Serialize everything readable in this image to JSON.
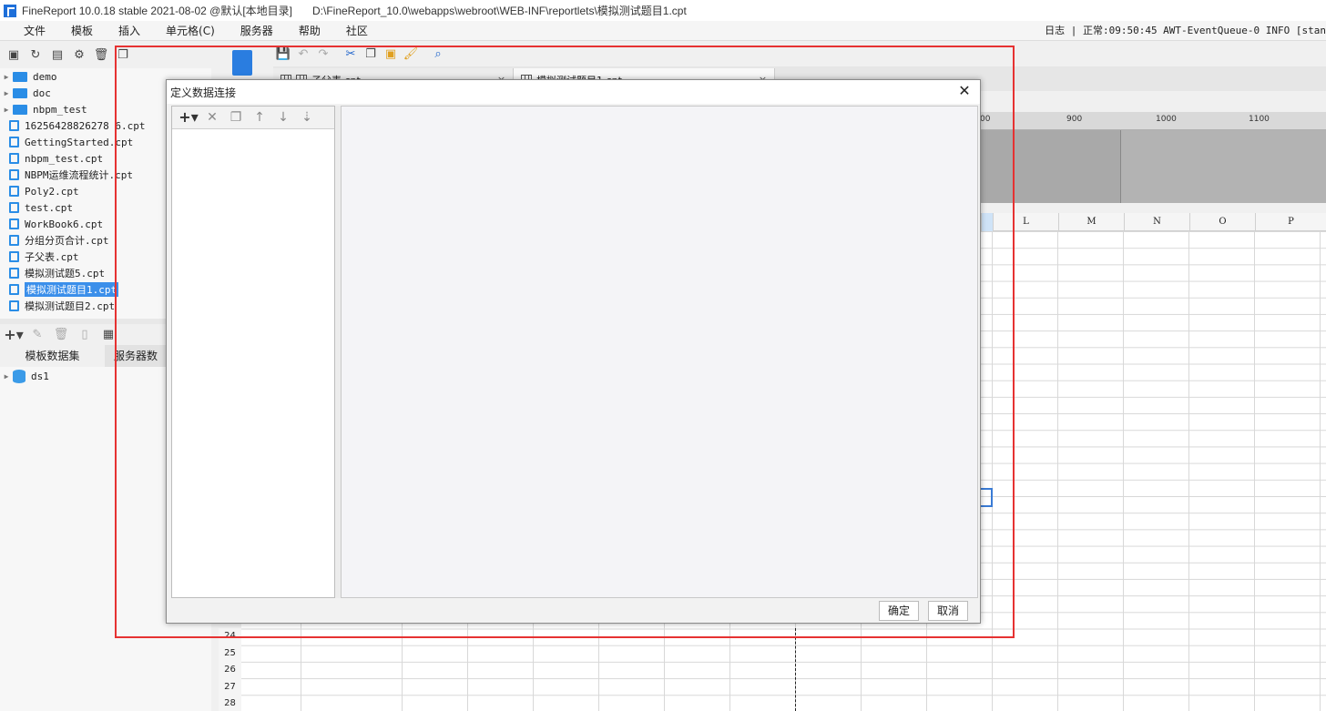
{
  "window": {
    "title": "FineReport 10.0.18 stable 2021-08-02 @默认[本地目录]",
    "path": "D:\\FineReport_10.0\\webapps\\webroot\\WEB-INF\\reportlets\\模拟测试题目1.cpt"
  },
  "menu": [
    "文件",
    "模板",
    "插入",
    "单元格(C)",
    "服务器",
    "帮助",
    "社区"
  ],
  "status": "日志 | 正常:09:50:45 AWT-EventQueue-0 INFO [stan",
  "tree": {
    "items": [
      {
        "label": "demo",
        "type": "folder"
      },
      {
        "label": "doc",
        "type": "folder"
      },
      {
        "label": "nbpm_test",
        "type": "folder"
      },
      {
        "label": "16256428826278 6.cpt",
        "type": "file"
      },
      {
        "label": "GettingStarted.cpt",
        "type": "file"
      },
      {
        "label": "nbpm_test.cpt",
        "type": "file"
      },
      {
        "label": "NBPM运维流程统计.cpt",
        "type": "file"
      },
      {
        "label": "Poly2.cpt",
        "type": "file"
      },
      {
        "label": "test.cpt",
        "type": "file"
      },
      {
        "label": "WorkBook6.cpt",
        "type": "file"
      },
      {
        "label": "分组分页合计.cpt",
        "type": "file"
      },
      {
        "label": "子父表.cpt",
        "type": "file"
      },
      {
        "label": "模拟测试题5.cpt",
        "type": "file"
      },
      {
        "label": "模拟测试题目1.cpt",
        "type": "file",
        "selected": true
      },
      {
        "label": "模拟测试题目2.cpt",
        "type": "file"
      }
    ]
  },
  "dataset": {
    "tabs": [
      "模板数据集",
      "服务器数"
    ],
    "items": [
      "ds1"
    ]
  },
  "doc_tabs": [
    {
      "label": "子父表.cpt"
    },
    {
      "label": "模拟测试题目1.cpt",
      "active": true
    }
  ],
  "ruler_ticks": [
    "00",
    "900",
    "1000",
    "1100"
  ],
  "columns": [
    "L",
    "M",
    "N",
    "O",
    "P"
  ],
  "rows": [
    "24",
    "25",
    "26",
    "27",
    "28"
  ],
  "dialog": {
    "title": "定义数据连接",
    "close_label": "✕",
    "ok_label": "确定",
    "cancel_label": "取消"
  }
}
